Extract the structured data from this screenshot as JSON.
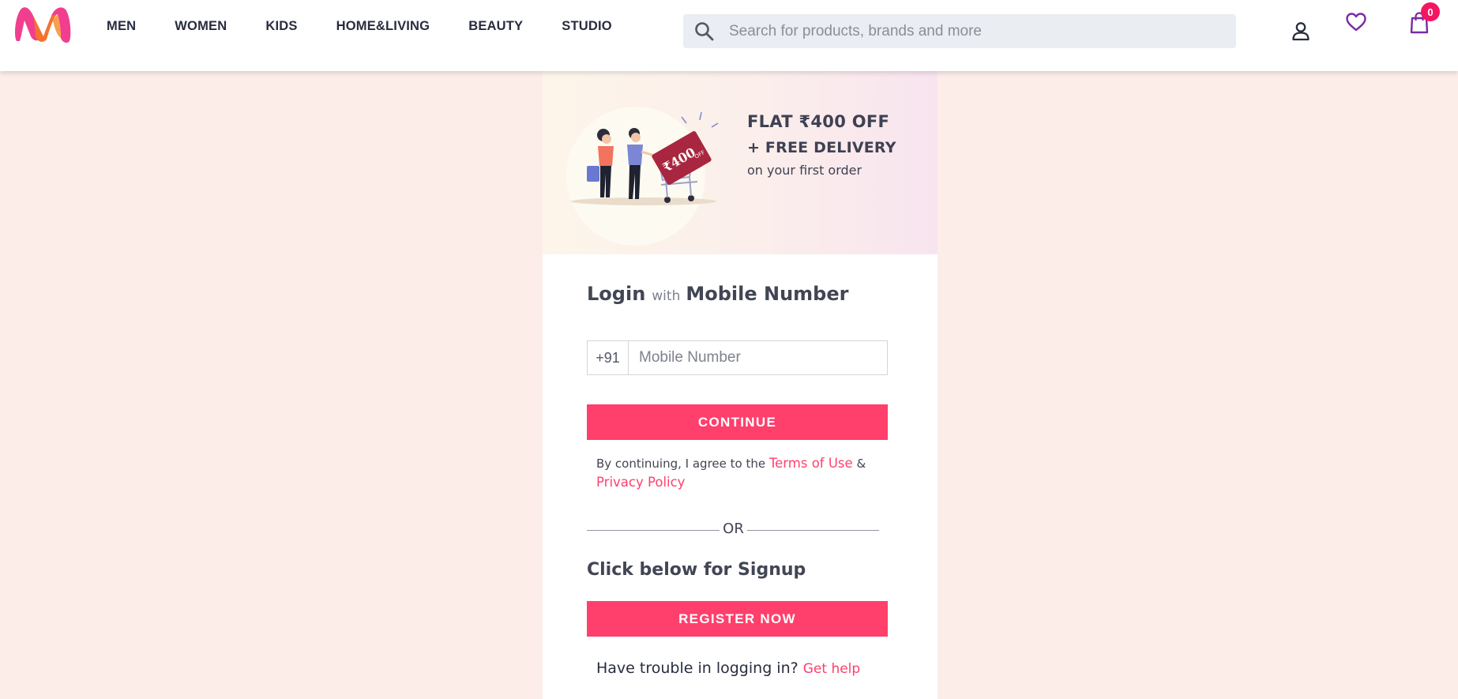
{
  "header": {
    "nav": [
      "MEN",
      "WOMEN",
      "KIDS",
      "HOME&LIVING",
      "BEAUTY",
      "STUDIO"
    ],
    "search_placeholder": "Search for products, brands and more",
    "bag_count": "0",
    "icons": [
      "profile-icon",
      "wishlist-icon",
      "bag-icon"
    ]
  },
  "banner": {
    "line1": "FLAT ₹400 OFF",
    "line2": "+ FREE DELIVERY",
    "line3": "on your first order",
    "tag_text": "₹400",
    "tag_sub": "OFF"
  },
  "login": {
    "title_login": "Login",
    "title_with": "with",
    "title_mobile": "Mobile Number",
    "country_code": "+91",
    "mobile_placeholder": "Mobile Number",
    "continue_label": "CONTINUE",
    "terms_prefix": "By continuing, I agree to the",
    "terms_link": "Terms of Use",
    "terms_amp": "&",
    "privacy_link": "Privacy Policy",
    "or_text": "OR",
    "signup_title": "Click below for Signup",
    "register_label": "REGISTER NOW",
    "trouble_text": "Have trouble in logging in?",
    "help_link": "Get help"
  },
  "colors": {
    "accent": "#ff3f6c",
    "page_bg": "#fcede9",
    "wishlist": "#7b2ba3",
    "badge": "#f41662"
  }
}
